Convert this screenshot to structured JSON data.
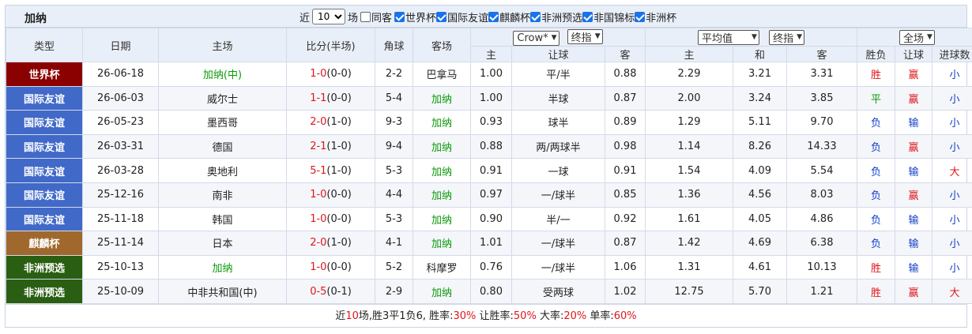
{
  "team": "加纳",
  "filters": {
    "recent_prefix": "近",
    "recent_count": "10",
    "recent_suffix": "场",
    "same_home_label": "同客",
    "competitions": [
      {
        "label": "世界杯",
        "checked": true
      },
      {
        "label": "国际友谊",
        "checked": true
      },
      {
        "label": "麒麟杯",
        "checked": true
      },
      {
        "label": "非洲预选",
        "checked": true
      },
      {
        "label": "非国锦标",
        "checked": true
      },
      {
        "label": "非洲杯",
        "checked": true
      }
    ]
  },
  "headers": {
    "type": "类型",
    "date": "日期",
    "home": "主场",
    "score": "比分(半场)",
    "corner": "角球",
    "away": "客场",
    "company": "Crow*",
    "handicap_mode": "终指",
    "odds_mode": "平均值",
    "odds_stage": "终指",
    "scope": "全场",
    "sub": {
      "h_home": "主",
      "h_line": "让球",
      "h_away": "客",
      "o_home": "主",
      "o_draw": "和",
      "o_away": "客",
      "result": "胜负",
      "hc_result": "让球",
      "goals": "进球数"
    }
  },
  "type_colors": {
    "世界杯": "#8b0000",
    "国际友谊": "#4169c8",
    "麒麟杯": "#a0682c",
    "非洲预选": "#2a5e12"
  },
  "rows": [
    {
      "type": "世界杯",
      "date": "26-06-18",
      "home": "加纳(中)",
      "home_ghana": true,
      "score": "1-0",
      "half": "(0-0)",
      "corner": "2-2",
      "away": "巴拿马",
      "away_ghana": false,
      "h_home": "1.00",
      "h_line": "平/半",
      "h_away": "0.88",
      "o_home": "2.29",
      "o_draw": "3.21",
      "o_away": "3.31",
      "result": "胜",
      "hc": "赢",
      "goals": "小"
    },
    {
      "type": "国际友谊",
      "date": "26-06-03",
      "home": "威尔士",
      "home_ghana": false,
      "score": "1-1",
      "half": "(0-0)",
      "corner": "5-4",
      "away": "加纳",
      "away_ghana": true,
      "h_home": "1.00",
      "h_line": "半球",
      "h_away": "0.87",
      "o_home": "2.00",
      "o_draw": "3.24",
      "o_away": "3.85",
      "result": "平",
      "hc": "赢",
      "goals": "小"
    },
    {
      "type": "国际友谊",
      "date": "26-05-23",
      "home": "墨西哥",
      "home_ghana": false,
      "score": "2-0",
      "half": "(1-0)",
      "corner": "9-3",
      "away": "加纳",
      "away_ghana": true,
      "h_home": "0.93",
      "h_line": "球半",
      "h_away": "0.89",
      "o_home": "1.29",
      "o_draw": "5.11",
      "o_away": "9.70",
      "result": "负",
      "hc": "输",
      "goals": "小"
    },
    {
      "type": "国际友谊",
      "date": "26-03-31",
      "home": "德国",
      "home_ghana": false,
      "score": "2-1",
      "half": "(1-0)",
      "corner": "9-4",
      "away": "加纳",
      "away_ghana": true,
      "h_home": "0.88",
      "h_line": "两/两球半",
      "h_away": "0.98",
      "o_home": "1.14",
      "o_draw": "8.26",
      "o_away": "14.33",
      "result": "负",
      "hc": "赢",
      "goals": "小"
    },
    {
      "type": "国际友谊",
      "date": "26-03-28",
      "home": "奥地利",
      "home_ghana": false,
      "score": "5-1",
      "half": "(1-0)",
      "corner": "5-3",
      "away": "加纳",
      "away_ghana": true,
      "h_home": "0.91",
      "h_line": "一球",
      "h_away": "0.91",
      "o_home": "1.54",
      "o_draw": "4.09",
      "o_away": "5.54",
      "result": "负",
      "hc": "输",
      "goals": "大"
    },
    {
      "type": "国际友谊",
      "date": "25-12-16",
      "home": "南非",
      "home_ghana": false,
      "score": "1-0",
      "half": "(0-0)",
      "corner": "4-4",
      "away": "加纳",
      "away_ghana": true,
      "h_home": "0.97",
      "h_line": "一/球半",
      "h_away": "0.85",
      "o_home": "1.36",
      "o_draw": "4.56",
      "o_away": "8.03",
      "result": "负",
      "hc": "赢",
      "goals": "小"
    },
    {
      "type": "国际友谊",
      "date": "25-11-18",
      "home": "韩国",
      "home_ghana": false,
      "score": "1-0",
      "half": "(0-0)",
      "corner": "5-3",
      "away": "加纳",
      "away_ghana": true,
      "h_home": "0.90",
      "h_line": "半/一",
      "h_away": "0.92",
      "o_home": "1.61",
      "o_draw": "4.05",
      "o_away": "4.86",
      "result": "负",
      "hc": "输",
      "goals": "小"
    },
    {
      "type": "麒麟杯",
      "date": "25-11-14",
      "home": "日本",
      "home_ghana": false,
      "score": "2-0",
      "half": "(1-0)",
      "corner": "4-1",
      "away": "加纳",
      "away_ghana": true,
      "h_home": "1.01",
      "h_line": "一/球半",
      "h_away": "0.87",
      "o_home": "1.42",
      "o_draw": "4.69",
      "o_away": "6.38",
      "result": "负",
      "hc": "输",
      "goals": "小"
    },
    {
      "type": "非洲预选",
      "date": "25-10-13",
      "home": "加纳",
      "home_ghana": true,
      "score": "1-0",
      "half": "(0-0)",
      "corner": "5-2",
      "away": "科摩罗",
      "away_ghana": false,
      "h_home": "0.76",
      "h_line": "一/球半",
      "h_away": "1.06",
      "o_home": "1.31",
      "o_draw": "4.61",
      "o_away": "10.13",
      "result": "胜",
      "hc": "输",
      "goals": "小"
    },
    {
      "type": "非洲预选",
      "date": "25-10-09",
      "home": "中非共和国(中)",
      "home_ghana": false,
      "score": "0-5",
      "half": "(0-1)",
      "corner": "2-9",
      "away": "加纳",
      "away_ghana": true,
      "h_home": "0.80",
      "h_line": "受两球",
      "h_away": "1.02",
      "o_home": "12.75",
      "o_draw": "5.70",
      "o_away": "1.21",
      "result": "胜",
      "hc": "赢",
      "goals": "大"
    }
  ],
  "summary": {
    "p1": "近",
    "games": "10",
    "p2": "场,胜3平1负6, 胜率:",
    "win_rate": "30%",
    "p3": " 让胜率:",
    "hc_rate": "50%",
    "p4": " 大率:",
    "big_rate": "20%",
    "p5": " 单率:",
    "odd_rate": "60%"
  }
}
